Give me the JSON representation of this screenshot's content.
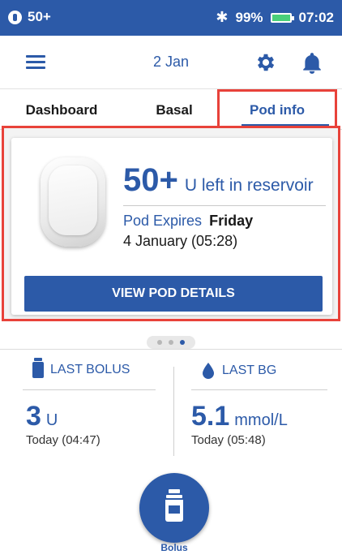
{
  "status_bar": {
    "reservoir": "50+",
    "battery_percent": "99%",
    "time": "07:02",
    "bluetooth_icon": "bluetooth-icon",
    "battery_icon": "battery-icon",
    "colors": {
      "background": "#2c5aa8",
      "battery_fill": "#49d07a"
    }
  },
  "header": {
    "date": "2 Jan",
    "menu_icon": "menu-icon",
    "settings_icon": "gear-icon",
    "notifications_icon": "bell-icon"
  },
  "tabs": [
    {
      "label": "Dashboard",
      "active": false
    },
    {
      "label": "Basal",
      "active": false
    },
    {
      "label": "Pod info",
      "active": true
    }
  ],
  "pod_card": {
    "reservoir_value": "50+",
    "reservoir_text": "U left in reservoir",
    "expires_label": "Pod Expires",
    "expires_day": "Friday",
    "expires_date": "4 January (05:28)",
    "button_label": "VIEW POD DETAILS",
    "highlight_color": "#e8423a"
  },
  "pager": {
    "pages": 3,
    "active_index": 2
  },
  "last_bolus": {
    "label": "LAST BOLUS",
    "value": "3",
    "unit": "U",
    "time": "Today (04:47)"
  },
  "last_bg": {
    "label": "LAST BG",
    "value": "5.1",
    "unit": "mmol/L",
    "time": "Today (05:48)"
  },
  "bolus_button": {
    "label": "Bolus",
    "icon": "insulin-vial-icon"
  },
  "accent_color": "#2c5aa8"
}
